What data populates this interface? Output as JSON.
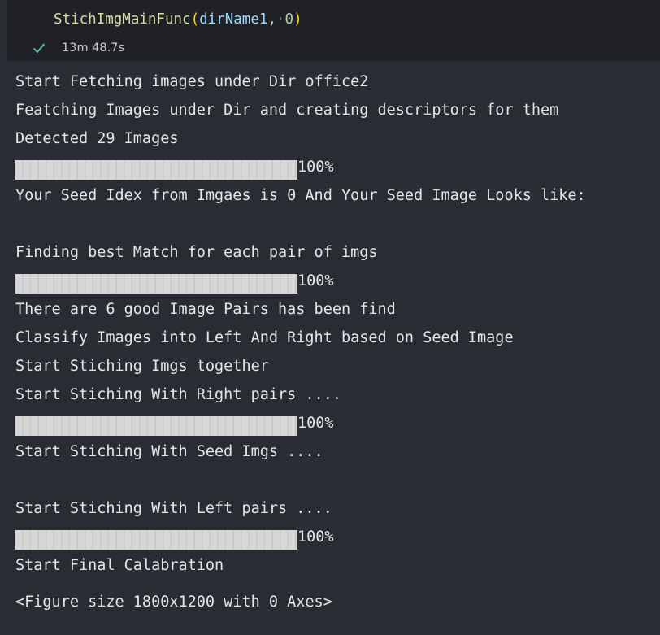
{
  "cell": {
    "code": {
      "function": "StichImgMainFunc",
      "open_paren": "(",
      "arg1": "dirName1",
      "comma": ",",
      "space_dot": "·",
      "arg2": "0",
      "close_paren": ")"
    },
    "status": {
      "icon": "check-icon",
      "execution_time": "13m 48.7s"
    }
  },
  "output": {
    "line1": "Start Fetching images under Dir office2",
    "line2": "Featching Images under Dir and creating descriptors for them",
    "line3": "Detected 29 Images",
    "progress1": {
      "percent_label": "100%",
      "fraction": 1.0
    },
    "line4": "Your Seed Idex from Imgaes is 0 And Your Seed Image Looks like:",
    "line5": "Finding best Match for each pair of imgs",
    "progress2": {
      "percent_label": "100%",
      "fraction": 1.0
    },
    "line6": "There are 6 good Image Pairs has been find",
    "line7": "Classify Images into Left And Right based on Seed Image",
    "line8": "Start Stiching Imgs together",
    "line9": "Start Stiching With Right pairs ....",
    "progress3": {
      "percent_label": "100%",
      "fraction": 1.0
    },
    "line10": "Start Stiching With Seed Imgs ....",
    "line11": "Start Stiching With Left pairs ....",
    "progress4": {
      "percent_label": "100%",
      "fraction": 1.0
    },
    "line12": "Start Final Calabration",
    "figure_repr": "<Figure size 1800x1200 with 0 Axes>"
  },
  "colors": {
    "background": "#292c33",
    "cell_background": "#1f2127",
    "success_check": "#4ec9b0",
    "progress_bar": "#e4e4e4"
  }
}
